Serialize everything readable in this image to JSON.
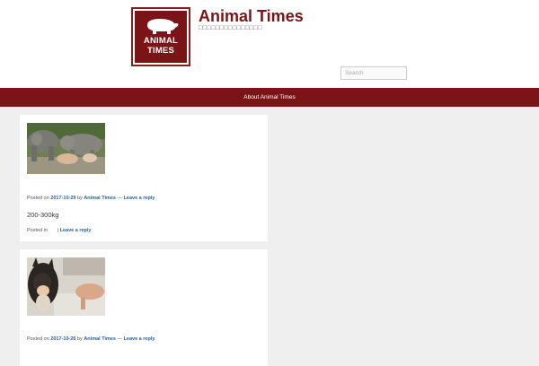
{
  "site": {
    "logo_line1": "ANIMAL",
    "logo_line2": "TIMES",
    "title": "Animal Times",
    "description": "□□□□□□□□□□□□□□□"
  },
  "search": {
    "placeholder": "Search"
  },
  "nav": {
    "items": [
      {
        "label": "About Animal Times"
      }
    ]
  },
  "posts": [
    {
      "thumbnail": "elephants-photo",
      "posted_on_label": "Posted on",
      "date": "2017-10-29",
      "by_label": "by",
      "author": "Animal Times",
      "separator": "—",
      "reply": "Leave a reply",
      "excerpt": "200-300kg",
      "footer_posted_in": "Posted in",
      "footer_sep": "|",
      "footer_reply": "Leave a reply"
    },
    {
      "thumbnail": "shiba-dog-photo",
      "posted_on_label": "Posted on",
      "date": "2017-10-26",
      "by_label": "by",
      "author": "Animal Times",
      "separator": "—",
      "reply": "Leave a reply"
    }
  ],
  "colors": {
    "brand": "#7b1416",
    "link": "#2a5f9e",
    "background": "#efefef"
  }
}
